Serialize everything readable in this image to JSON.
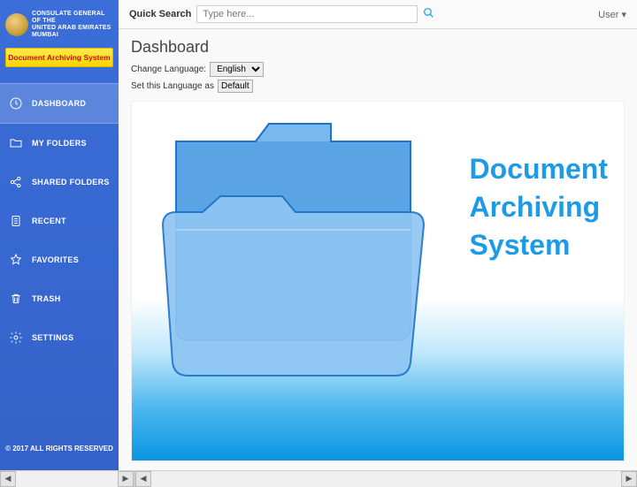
{
  "brand": {
    "line1": "CONSULATE GENERAL OF THE",
    "line2": "UNITED ARAB EMIRATES",
    "line3": "MUMBAI"
  },
  "yellow_button": "Document Archiving System",
  "nav": [
    {
      "key": "dashboard",
      "label": "DASHBOARD",
      "active": true
    },
    {
      "key": "my-folders",
      "label": "MY FOLDERS",
      "active": false
    },
    {
      "key": "shared-folders",
      "label": "SHARED FOLDERS",
      "active": false
    },
    {
      "key": "recent",
      "label": "RECENT",
      "active": false
    },
    {
      "key": "favorites",
      "label": "FAVORITES",
      "active": false
    },
    {
      "key": "trash",
      "label": "TRASH",
      "active": false
    },
    {
      "key": "settings",
      "label": "SETTINGS",
      "active": false
    }
  ],
  "copyright": "© 2017 ALL RIGHTS RESERVED",
  "topbar": {
    "quick_search_label": "Quick Search",
    "quick_search_placeholder": "Type here...",
    "user_label": "User"
  },
  "page": {
    "title": "Dashboard",
    "change_language_label": "Change Language:",
    "language_options": [
      "English"
    ],
    "language_selected": "English",
    "set_language_label": "Set this Language as",
    "default_button": "Default"
  },
  "hero": {
    "line1": "Document",
    "line2": "Archiving",
    "line3": "System"
  }
}
